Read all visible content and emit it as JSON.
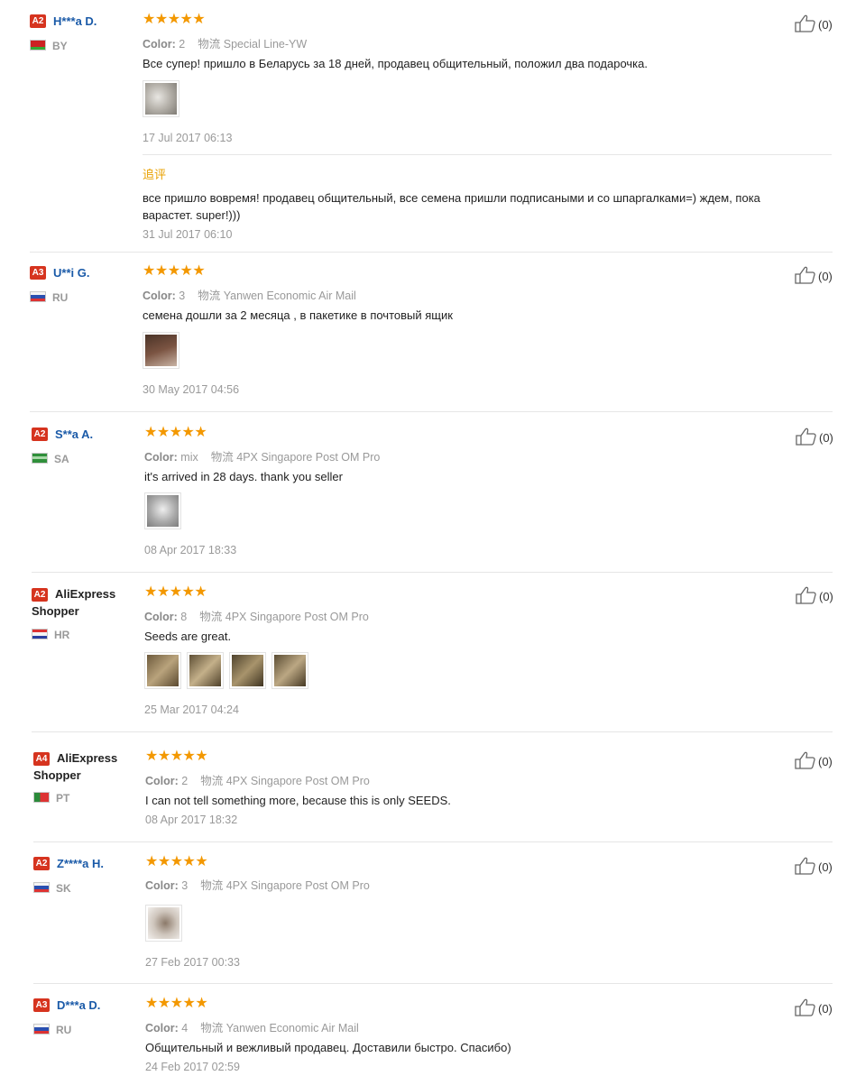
{
  "reviews": [
    {
      "level": "A2",
      "name": "H***a D.",
      "country": "BY",
      "color_label": "Color:",
      "color_value": "2",
      "logistics_label": "物流",
      "logistics": "Special Line-YW",
      "text": "Все супер! пришло в Беларусь за 18 дней, продавец общительный, положил два подарочка.",
      "date": "17 Jul 2017 06:13",
      "append_label": "追评",
      "append_text": "все пришло вовремя! продавец общительный, все семена пришли подписаными и со шпаргалками=) ждем, пока варастет. super!)))",
      "append_date": "31 Jul 2017 06:10",
      "likes": "(0)",
      "stars": "★★★★★"
    },
    {
      "level": "A3",
      "name": "U**i G.",
      "country": "RU",
      "color_label": "Color:",
      "color_value": "3",
      "logistics_label": "物流",
      "logistics": "Yanwen Economic Air Mail",
      "text": "семена дошли за 2 месяца , в пакетике в почтовый ящик",
      "date": "30 May 2017 04:56",
      "likes": "(0)",
      "stars": "★★★★★"
    },
    {
      "level": "A2",
      "name": "S**a A.",
      "country": "SA",
      "color_label": "Color:",
      "color_value": "mix",
      "logistics_label": "物流",
      "logistics": "4PX Singapore Post OM Pro",
      "text": "it's arrived in 28 days. thank you seller",
      "date": "08 Apr 2017 18:33",
      "likes": "(0)",
      "stars": "★★★★★"
    },
    {
      "level": "A2",
      "name": "AliExpress Shopper",
      "country": "HR",
      "color_label": "Color:",
      "color_value": "8",
      "logistics_label": "物流",
      "logistics": "4PX Singapore Post OM Pro",
      "text": "Seeds are great.",
      "date": "25 Mar 2017 04:24",
      "likes": "(0)",
      "stars": "★★★★★"
    },
    {
      "level": "A4",
      "name": "AliExpress Shopper",
      "country": "PT",
      "color_label": "Color:",
      "color_value": "2",
      "logistics_label": "物流",
      "logistics": "4PX Singapore Post OM Pro",
      "text": "I can not tell something more, because this is only SEEDS.",
      "date": "08 Apr 2017 18:32",
      "likes": "(0)",
      "stars": "★★★★★"
    },
    {
      "level": "A2",
      "name": "Z****a H.",
      "country": "SK",
      "color_label": "Color:",
      "color_value": "3",
      "logistics_label": "物流",
      "logistics": "4PX Singapore Post OM Pro",
      "text": "",
      "date": "27 Feb 2017 00:33",
      "likes": "(0)",
      "stars": "★★★★★"
    },
    {
      "level": "A3",
      "name": "D***a D.",
      "country": "RU",
      "color_label": "Color:",
      "color_value": "4",
      "logistics_label": "物流",
      "logistics": "Yanwen Economic Air Mail",
      "text": "Общительный и вежливый продавец. Доставили быстро. Спасибо)",
      "date": "24 Feb 2017 02:59",
      "likes": "(0)",
      "stars": "★★★★★"
    }
  ],
  "colors": {
    "star": "#f39800",
    "badge": "#d6341f",
    "name": "#1a5aa8",
    "append": "#e8a000"
  }
}
